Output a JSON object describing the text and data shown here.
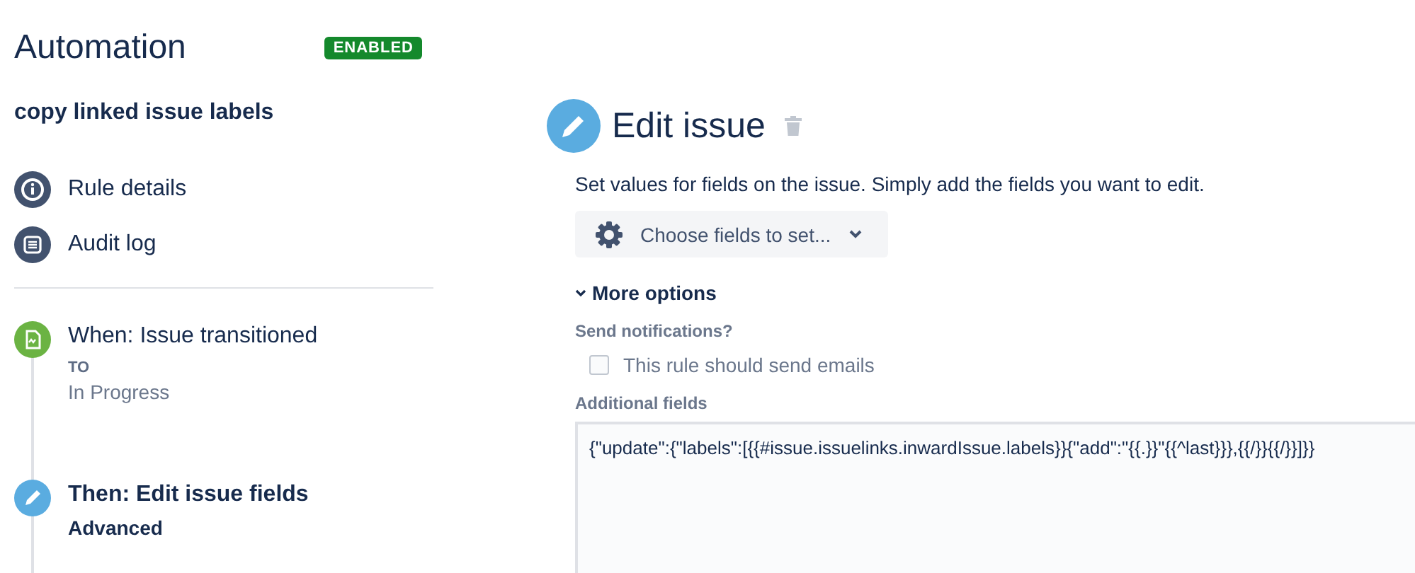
{
  "sidebar": {
    "title": "Automation",
    "status_badge": "ENABLED",
    "rule_name": "copy linked issue labels",
    "nav_items": [
      {
        "label": "Rule details",
        "kind": "info",
        "selected": false
      },
      {
        "label": "Audit log",
        "kind": "log",
        "selected": false
      }
    ],
    "steps": [
      {
        "kind": "trigger",
        "title": "When: Issue transitioned",
        "detail_label": "TO",
        "detail_value": "In Progress"
      },
      {
        "kind": "action",
        "title": "Then: Edit issue fields",
        "detail_value": "Advanced"
      }
    ]
  },
  "panel": {
    "title": "Edit issue",
    "description": "Set values for fields on the issue. Simply add the fields you want to edit.",
    "choose_button": "Choose fields to set...",
    "more_options": {
      "label": "More options",
      "expanded": true
    },
    "notifications": {
      "label": "Send notifications?",
      "checkbox_label": "This rule should send emails",
      "checked": false
    },
    "additional_fields": {
      "label": "Additional fields",
      "value": "{\"update\":{\"labels\":[{{#issue.issuelinks.inwardIssue.labels}}{\"add\":\"{{.}}\"{{^last}}},{{/}}{{/}}]}}"
    }
  }
}
